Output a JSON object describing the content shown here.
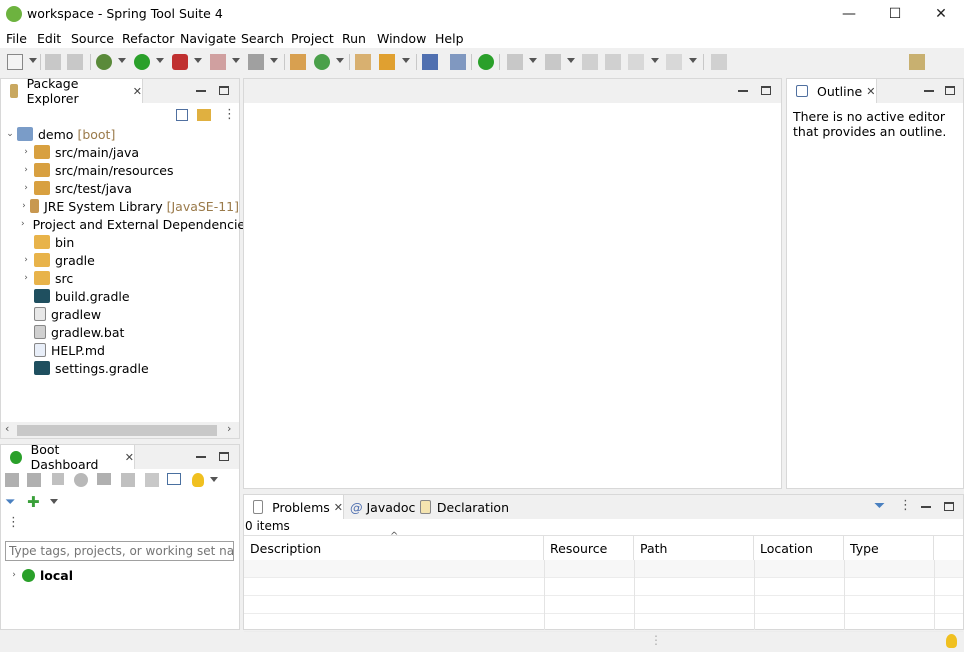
{
  "window": {
    "title": "workspace - Spring Tool Suite 4",
    "minimize": "—",
    "maximize": "☐",
    "close": "✕"
  },
  "menu": [
    "File",
    "Edit",
    "Source",
    "Refactor",
    "Navigate",
    "Search",
    "Project",
    "Run",
    "Window",
    "Help"
  ],
  "package_explorer": {
    "tab_label": "Package Explorer",
    "project": {
      "name": "demo",
      "decoration": "[boot]"
    },
    "items": [
      {
        "label": "src/main/java",
        "decoration": "",
        "icon": "source-folder-icon",
        "expandable": true
      },
      {
        "label": "src/main/resources",
        "decoration": "",
        "icon": "source-folder-icon",
        "expandable": true
      },
      {
        "label": "src/test/java",
        "decoration": "",
        "icon": "source-folder-icon",
        "expandable": true
      },
      {
        "label": "JRE System Library",
        "decoration": "[JavaSE-11]",
        "icon": "library-icon",
        "expandable": true
      },
      {
        "label": "Project and External Dependencies",
        "decoration": "",
        "icon": "library-icon",
        "expandable": true
      },
      {
        "label": "bin",
        "decoration": "",
        "icon": "folder-icon",
        "expandable": false
      },
      {
        "label": "gradle",
        "decoration": "",
        "icon": "folder-icon",
        "expandable": true
      },
      {
        "label": "src",
        "decoration": "",
        "icon": "folder-icon",
        "expandable": true
      },
      {
        "label": "build.gradle",
        "decoration": "",
        "icon": "gradle-file-icon",
        "expandable": false
      },
      {
        "label": "gradlew",
        "decoration": "",
        "icon": "text-file-icon",
        "expandable": false
      },
      {
        "label": "gradlew.bat",
        "decoration": "",
        "icon": "batch-file-icon",
        "expandable": false
      },
      {
        "label": "HELP.md",
        "decoration": "",
        "icon": "markdown-file-icon",
        "expandable": false
      },
      {
        "label": "settings.gradle",
        "decoration": "",
        "icon": "gradle-file-icon",
        "expandable": false
      }
    ]
  },
  "boot_dashboard": {
    "tab_label": "Boot Dashboard",
    "filter_placeholder": "Type tags, projects, or working set names",
    "local_label": "local"
  },
  "outline": {
    "tab_label": "Outline",
    "message": "There is no active editor that provides an outline."
  },
  "bottom": {
    "tabs": {
      "problems": "Problems",
      "javadoc": "Javadoc",
      "declaration": "Declaration"
    },
    "items_count": "0 items",
    "columns": [
      "Description",
      "Resource",
      "Path",
      "Location",
      "Type"
    ]
  },
  "colors": {
    "spring_green": "#6db33f",
    "folder": "#e8b34a",
    "decoration": "#9a7a4a"
  }
}
